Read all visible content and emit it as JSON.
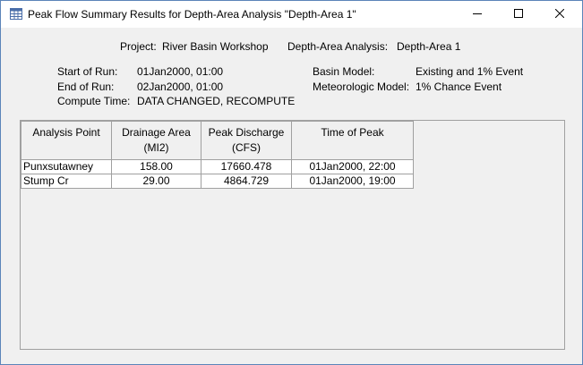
{
  "window": {
    "title": "Peak Flow Summary Results for Depth-Area Analysis \"Depth-Area 1\"",
    "icon": "table-icon",
    "controls": [
      "minimize-icon",
      "maximize-icon",
      "close-icon"
    ]
  },
  "header": {
    "project_label": "Project:",
    "project_value": "River Basin Workshop",
    "analysis_label": "Depth-Area Analysis:",
    "analysis_value": "Depth-Area 1"
  },
  "run_info": {
    "start_label": "Start of Run:",
    "start_value": "01Jan2000, 01:00",
    "end_label": "End of Run:",
    "end_value": "02Jan2000, 01:00",
    "compute_label": "Compute Time:",
    "compute_value": "DATA CHANGED, RECOMPUTE",
    "basin_label": "Basin Model:",
    "basin_value": "Existing and 1% Event",
    "met_label": "Meteorologic Model:",
    "met_value": "1% Chance Event"
  },
  "table": {
    "columns": [
      {
        "line1": "Analysis Point",
        "line2": ""
      },
      {
        "line1": "Drainage Area",
        "line2": "(MI2)"
      },
      {
        "line1": "Peak Discharge",
        "line2": "(CFS)"
      },
      {
        "line1": "Time of Peak",
        "line2": ""
      }
    ],
    "rows": [
      [
        "Punxsutawney",
        "158.00",
        "17660.478",
        "01Jan2000, 22:00"
      ],
      [
        "Stump Cr",
        "29.00",
        "4864.729",
        "01Jan2000, 19:00"
      ]
    ]
  }
}
